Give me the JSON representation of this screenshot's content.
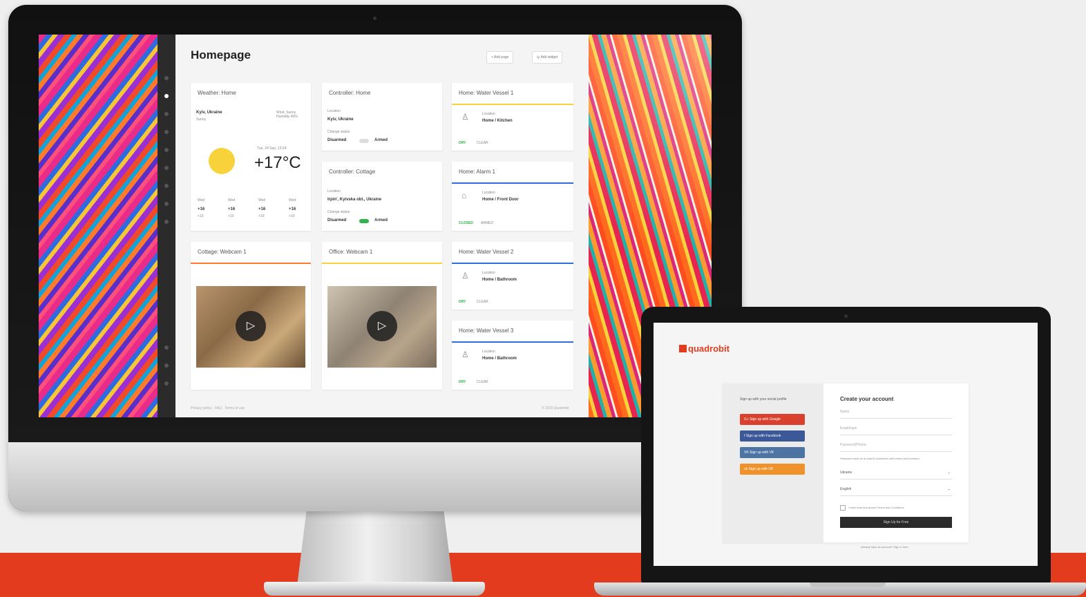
{
  "desktop": {
    "app_title": "Homepage",
    "toolbar": {
      "add_page_label": "+  Add page",
      "add_widget_label": "◎  Add widget"
    },
    "widgets": {
      "weather": {
        "title": "Weather: Home",
        "city": "Kyiv, Ukraine",
        "city_sub": "Sunny",
        "meta": "Wind, Sunny\nHumidity 40%",
        "datetime": "Tue, 24 Sep, 13:24",
        "temperature": "+17°C",
        "forecast": [
          {
            "day": "Wed",
            "temp": "+16",
            "sub": "+10"
          },
          {
            "day": "Wed",
            "temp": "+16",
            "sub": "+10"
          },
          {
            "day": "Wed",
            "temp": "+16",
            "sub": "+10"
          },
          {
            "day": "Wed",
            "temp": "+16",
            "sub": "+10"
          }
        ]
      },
      "controller_home": {
        "title": "Controller: Home",
        "location_label": "Location",
        "location": "Kyiv, Ukraine",
        "state_label": "Change status",
        "disarmed": "Disarmed",
        "armed": "Armed"
      },
      "controller_cottage": {
        "title": "Controller: Cottage",
        "location_label": "Location",
        "location": "Irpin', Kyivska obl., Ukraine",
        "state_label": "Change status",
        "disarmed": "Disarmed",
        "armed": "Armed"
      },
      "water_vessel_1": {
        "title": "Home: Water Vessel 1",
        "loc_label": "Location",
        "location": "Home / Kitchen",
        "status": "DRY",
        "status_sub": "CLEAR"
      },
      "alarm_1": {
        "title": "Home: Alarm 1",
        "loc_label": "Location",
        "location": "Home / Front Door",
        "status": "CLOSED",
        "status_sub": "ARMED"
      },
      "water_vessel_2": {
        "title": "Home: Water Vessel 2",
        "loc_label": "Location",
        "location": "Home / Bathroom",
        "status": "DRY",
        "status_sub": "CLEAR"
      },
      "water_vessel_3": {
        "title": "Home: Water Vessel 3",
        "loc_label": "Location",
        "location": "Home / Bathroom",
        "status": "DRY",
        "status_sub": "CLEAR"
      },
      "cottage_webcam": {
        "title": "Cottage: Webcam 1"
      },
      "office_webcam": {
        "title": "Office: Webcam 1"
      }
    },
    "footer": {
      "left": "Privacy policy   ·   FAQ   ·   Terms of use",
      "right": "© 2019 Quadrobit"
    },
    "colors": {
      "accent_red": "#e33b1d",
      "line_green": "#2fb34a",
      "line_yellow": "#f8d23a",
      "line_blue": "#2e6be0",
      "line_orange": "#ff7a2a"
    }
  },
  "laptop": {
    "logo": "quadrobit",
    "social_heading": "Sign up with your social profile",
    "social_buttons": [
      {
        "label": "G+   Sign up with Google",
        "color": "#d9412e"
      },
      {
        "label": "f    Sign up with Facebook",
        "color": "#3b5998"
      },
      {
        "label": "VK   Sign up with VK",
        "color": "#4c75a3"
      },
      {
        "label": "ok   Sign up with OK",
        "color": "#f0922b"
      }
    ],
    "form_title": "Create your account",
    "fields": [
      "Name",
      "Email/login",
      "Password/Phone"
    ],
    "hint": "Password must be at least 8 characters with letters and numbers",
    "selects": [
      "Ukraine",
      "English"
    ],
    "agree_text": "I have read and accept Terms and Conditions",
    "submit_label": "Sign Up for Free",
    "signin_text": "Already have an account? Sign in here"
  }
}
